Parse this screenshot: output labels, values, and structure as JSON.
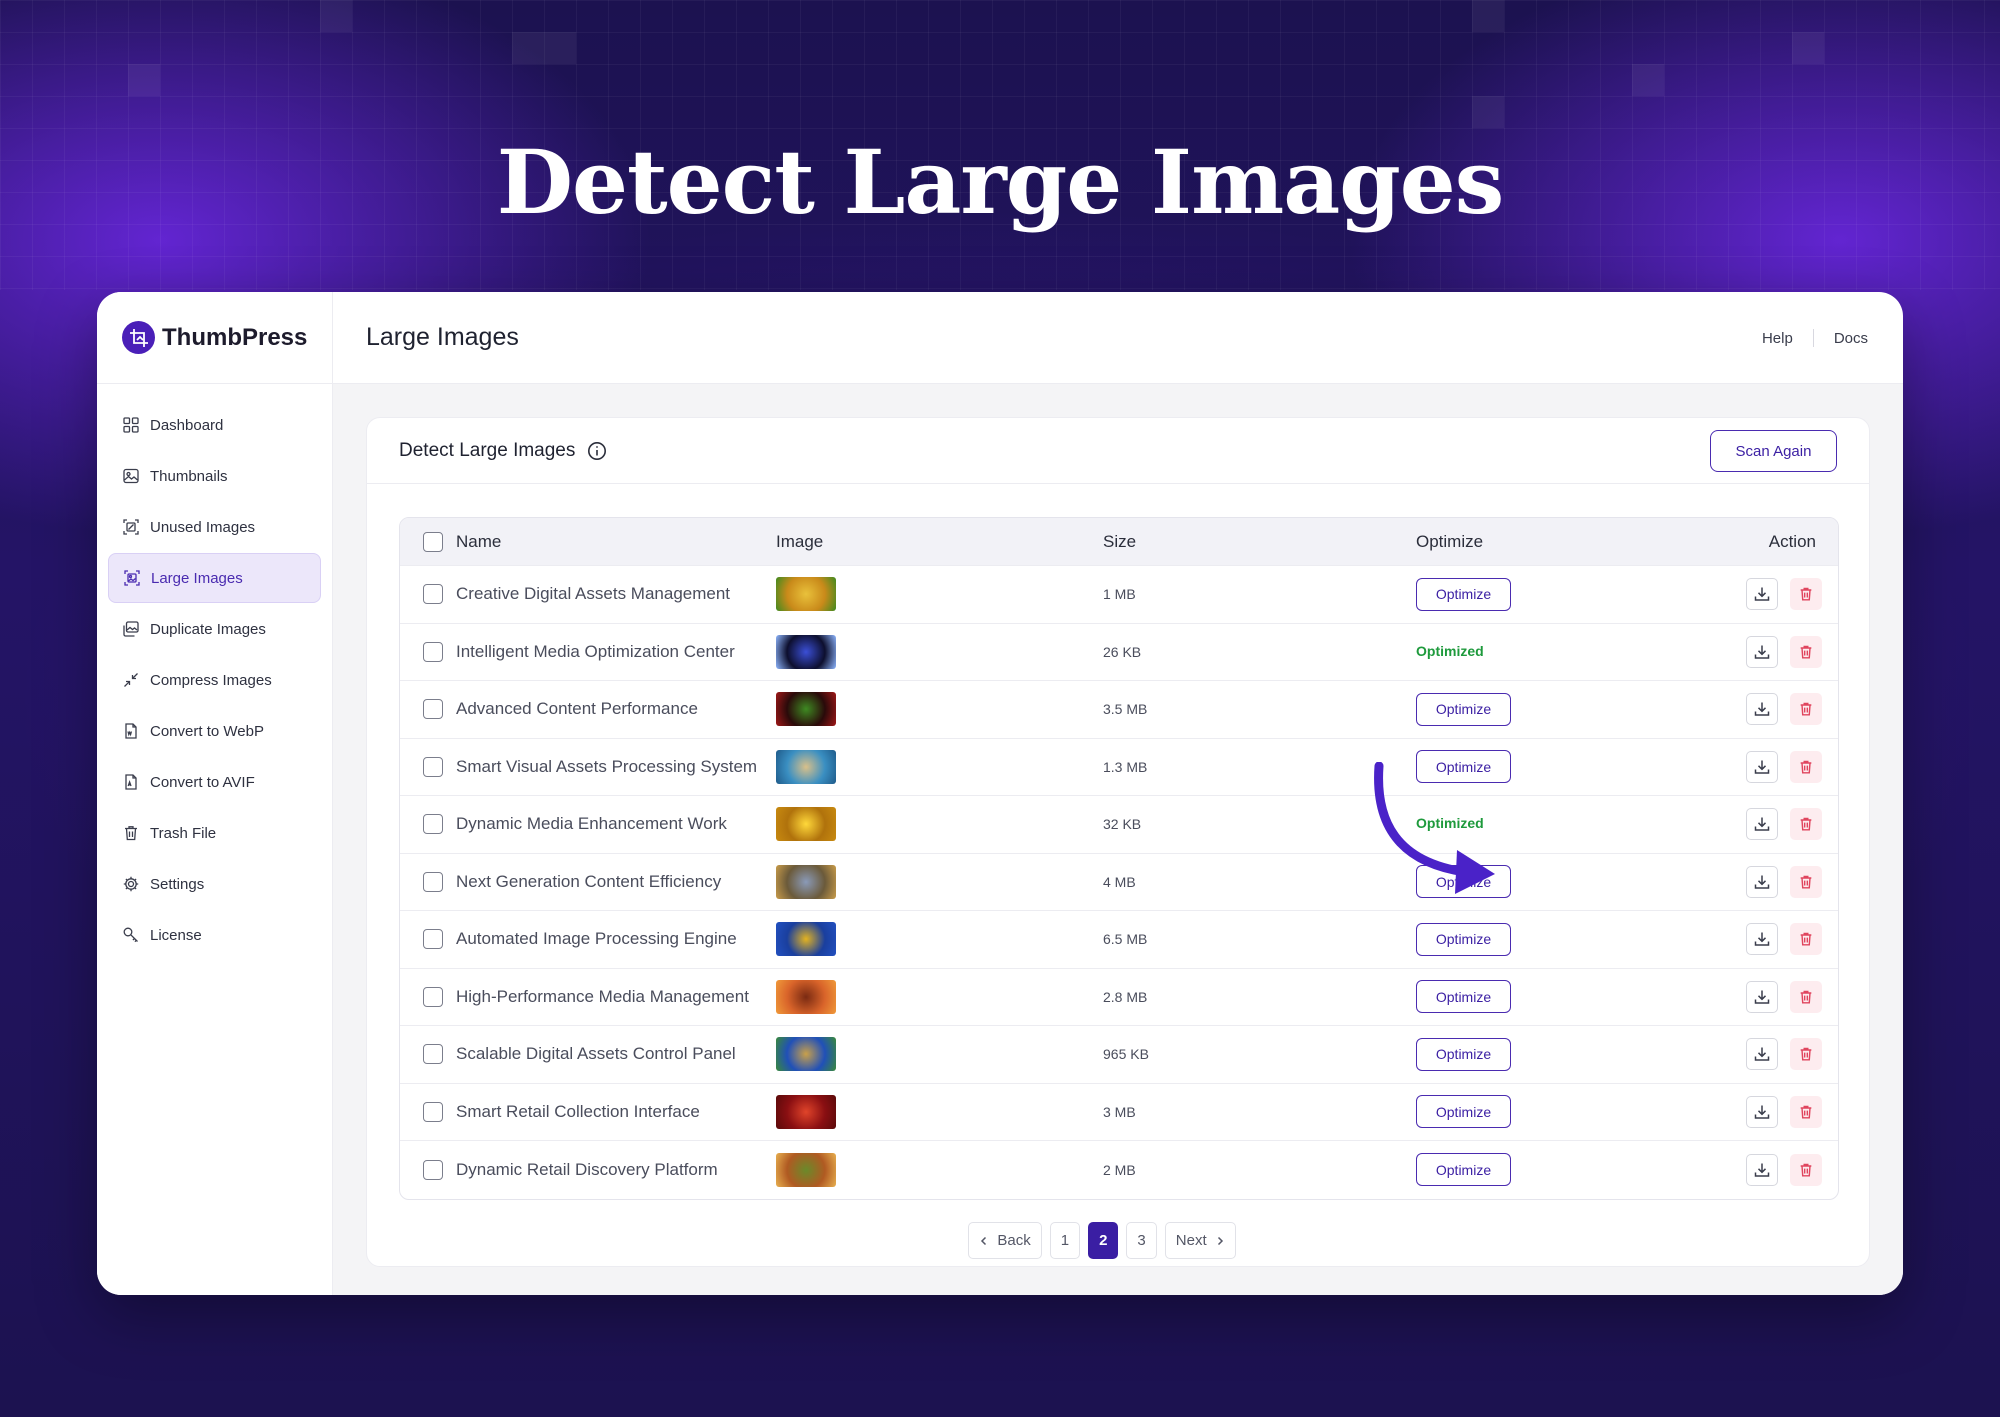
{
  "headline": "Detect Large Images",
  "brand": {
    "name": "ThumbPress"
  },
  "topbar": {
    "title": "Large Images",
    "help": "Help",
    "docs": "Docs"
  },
  "sidebar": {
    "items": [
      {
        "label": "Dashboard",
        "icon": "dashboard-icon",
        "active": false
      },
      {
        "label": "Thumbnails",
        "icon": "thumbnails-icon",
        "active": false
      },
      {
        "label": "Unused Images",
        "icon": "unused-images-icon",
        "active": false
      },
      {
        "label": "Large Images",
        "icon": "large-images-icon",
        "active": true
      },
      {
        "label": "Duplicate Images",
        "icon": "duplicate-images-icon",
        "active": false
      },
      {
        "label": "Compress Images",
        "icon": "compress-icon",
        "active": false
      },
      {
        "label": "Convert to WebP",
        "icon": "webp-file-icon",
        "active": false
      },
      {
        "label": "Convert to AVIF",
        "icon": "avif-file-icon",
        "active": false
      },
      {
        "label": "Trash File",
        "icon": "trash-icon",
        "active": false
      },
      {
        "label": "Settings",
        "icon": "gear-icon",
        "active": false
      },
      {
        "label": "License",
        "icon": "key-icon",
        "active": false
      }
    ]
  },
  "card": {
    "title": "Detect Large Images",
    "scan_button": "Scan Again"
  },
  "table": {
    "headers": {
      "name": "Name",
      "image": "Image",
      "size": "Size",
      "optimize": "Optimize",
      "action": "Action"
    },
    "optimize_label": "Optimize",
    "optimized_label": "Optimized",
    "rows": [
      {
        "name": "Creative Digital Assets Management",
        "size": "1 MB",
        "optimized": false,
        "thumb": [
          "#c98a1a",
          "#e9c13b",
          "#3f8a1f"
        ]
      },
      {
        "name": "Intelligent Media Optimization Center",
        "size": "26 KB",
        "optimized": true,
        "thumb": [
          "#0d0f2e",
          "#3b4fd6",
          "#8fb7ff"
        ]
      },
      {
        "name": "Advanced Content Performance",
        "size": "3.5 MB",
        "optimized": false,
        "thumb": [
          "#2a0a0a",
          "#3e8a22",
          "#a01818"
        ]
      },
      {
        "name": "Smart Visual Assets Processing System",
        "size": "1.3 MB",
        "optimized": false,
        "thumb": [
          "#3a8fc2",
          "#d9c08a",
          "#1f5b8a"
        ]
      },
      {
        "name": "Dynamic Media Enhancement Work",
        "size": "32 KB",
        "optimized": true,
        "thumb": [
          "#b0720c",
          "#ffd83a",
          "#c88a10"
        ]
      },
      {
        "name": "Next Generation Content Efficiency",
        "size": "4 MB",
        "optimized": false,
        "thumb": [
          "#6b5a3a",
          "#8a9ab8",
          "#c99c4a"
        ]
      },
      {
        "name": "Automated Image Processing Engine",
        "size": "6.5 MB",
        "optimized": false,
        "thumb": [
          "#1a3f9e",
          "#e3b320",
          "#2250c0"
        ]
      },
      {
        "name": "High-Performance Media Management",
        "size": "2.8 MB",
        "optimized": false,
        "thumb": [
          "#d9642a",
          "#7a2a12",
          "#f09a3a"
        ]
      },
      {
        "name": "Scalable Digital Assets Control Panel",
        "size": "965 KB",
        "optimized": false,
        "thumb": [
          "#2050b8",
          "#c9a04a",
          "#3a8a3a"
        ]
      },
      {
        "name": "Smart Retail Collection Interface",
        "size": "3 MB",
        "optimized": false,
        "thumb": [
          "#8a0f12",
          "#e0442a",
          "#5a0a0a"
        ]
      },
      {
        "name": "Dynamic Retail Discovery Platform",
        "size": "2 MB",
        "optimized": false,
        "thumb": [
          "#b05a22",
          "#6a8a2a",
          "#e8b050"
        ]
      }
    ]
  },
  "pagination": {
    "back": "Back",
    "pages": [
      "1",
      "2",
      "3"
    ],
    "current": "2",
    "next": "Next"
  },
  "colors": {
    "accent": "#4a2bb0",
    "success": "#1e9a3c",
    "danger": "#e0455e",
    "background": "#1c1250"
  }
}
